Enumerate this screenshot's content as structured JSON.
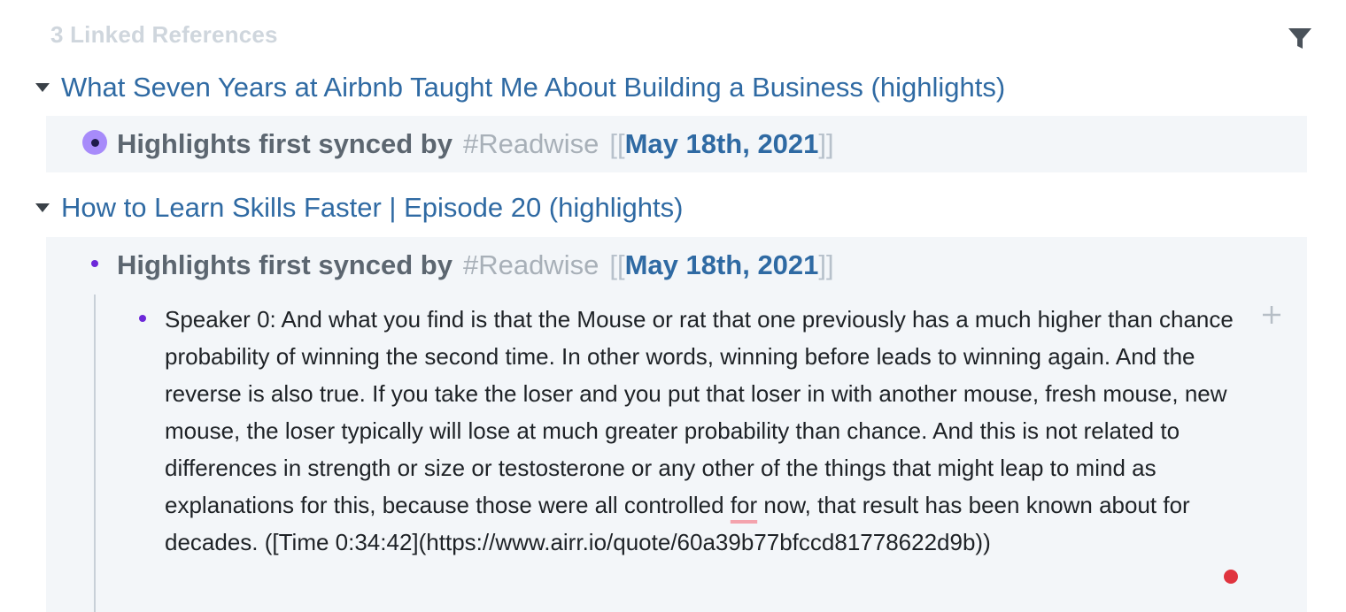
{
  "linked_refs": {
    "header": "3 Linked References",
    "filter_icon": "filter-icon"
  },
  "groups": [
    {
      "title": "What Seven Years at Airbnb Taught Me About Building a Business (highlights)",
      "block": {
        "prefix": "Highlights first synced by",
        "tag": "#Readwise",
        "open_brackets": "[[",
        "date_link": "May 18th, 2021",
        "close_brackets": "]]"
      }
    },
    {
      "title": "How to Learn Skills Faster | Episode 20 (highlights)",
      "block": {
        "prefix": "Highlights first synced by",
        "tag": "#Readwise",
        "open_brackets": "[[",
        "date_link": "May 18th, 2021",
        "close_brackets": "]]"
      },
      "child": {
        "text_before": "Speaker 0: And what you find is that the Mouse or rat that one previously has a much higher than chance probability of winning the second time. In other words, winning before leads to winning again. And the reverse is also true. If you take the loser and you put that loser in with another mouse, fresh mouse, new mouse, the loser typically will lose at much greater probability than chance. And this is not related to differences in strength or size or testosterone or any other of the things that might leap to mind as explanations for this, because those were all controlled ",
        "misspelled_word": "for",
        "text_after": " now, that result has been known about for decades. ([Time 0:34:42](https://www.airr.io/quote/60a39b77bfccd81778622d9b))"
      }
    }
  ],
  "colors": {
    "link": "#2f6aa3",
    "header": "#cfd6dd",
    "block_bg": "#f3f6f9",
    "bullet": "#6d28d9",
    "bullet_ring": "#a78bfa",
    "red_dot": "#e0343f"
  }
}
